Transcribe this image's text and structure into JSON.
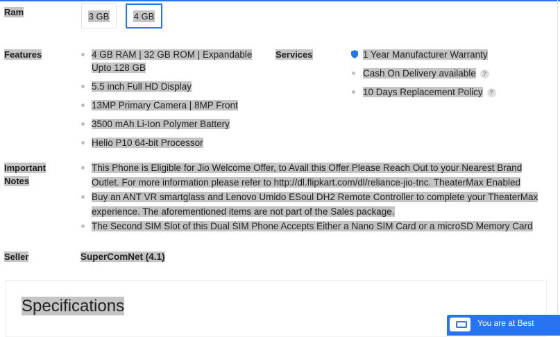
{
  "ram": {
    "label": "Ram",
    "options": [
      "3 GB",
      "4 GB"
    ],
    "selected": "4 GB"
  },
  "features": {
    "label": "Features",
    "items": [
      "4 GB RAM | 32 GB ROM | Expandable Upto 128 GB",
      "5.5 inch Full HD Display",
      "13MP Primary Camera | 8MP Front",
      "3500 mAh Li-Ion Polymer Battery",
      "Helio P10 64-bit Processor"
    ]
  },
  "services": {
    "label": "Services",
    "items": [
      {
        "text": "1 Year Manufacturer Warranty",
        "icon": "shield-icon"
      },
      {
        "text": "Cash On Delivery available",
        "icon": "help-icon",
        "help": "?"
      },
      {
        "text": "10 Days Replacement Policy",
        "icon": "help-icon",
        "help": "?"
      }
    ]
  },
  "notes": {
    "label_line1": "Important",
    "label_line2": "Notes",
    "items": [
      "This Phone is Eligible for Jio Welcome Offer, to Avail this Offer Please Reach Out to your Nearest Brand Outlet. For more information please refer to http://dl.flipkart.com/dl/reliance-jio-tnc. TheaterMax Enabled",
      "Buy an ANT VR smartglass and Lenovo Umido ESoul DH2 Remote Controller to complete your TheaterMax experience. The aforementioned items are not part of the Sales package.",
      "The Second SIM Slot of this Dual SIM Phone Accepts Either a Nano SIM Card or a microSD Memory Card"
    ]
  },
  "seller": {
    "label": "Seller",
    "name": "SuperComNet (4.1)"
  },
  "specifications": {
    "title": "Specifications"
  },
  "toast": {
    "text": "You are at Best"
  },
  "colors": {
    "accent": "#2874f0",
    "highlight": "#c4c4c4"
  }
}
